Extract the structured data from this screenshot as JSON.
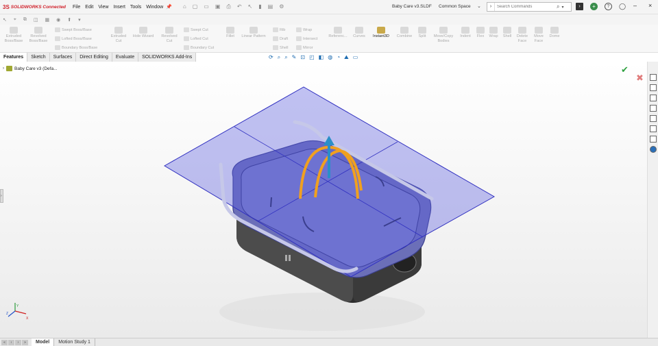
{
  "titlebar": {
    "logo_mark": "3S",
    "logo_text": "SOLIDWORKS Connected",
    "menu": [
      "File",
      "Edit",
      "View",
      "Insert",
      "Tools",
      "Window"
    ],
    "document_title": "Baby Care v3.SLDF",
    "space": "Common Space",
    "search_placeholder": "Search Commands",
    "cmd_glyph": "›"
  },
  "command_manager": {
    "tools": [
      {
        "label": "Extruded\nBoss/Base"
      },
      {
        "label": "Revolved\nBoss/Base"
      },
      {
        "label": "Extruded\nCut"
      },
      {
        "label": "Hole Wizard"
      },
      {
        "label": "Revolved\nCut"
      },
      {
        "label": "Fillet"
      },
      {
        "label": "Linear Pattern"
      },
      {
        "label": "Referenc..."
      },
      {
        "label": "Curves"
      },
      {
        "label": "Instant3D"
      },
      {
        "label": "Combine"
      },
      {
        "label": "Split"
      },
      {
        "label": "Move/Copy\nBodies"
      },
      {
        "label": "Indent"
      },
      {
        "label": "Flex"
      },
      {
        "label": "Wrap"
      },
      {
        "label": "Shell"
      },
      {
        "label": "Delete\nFace"
      },
      {
        "label": "Move\nFace"
      },
      {
        "label": "Dome"
      }
    ],
    "small_tools": {
      "swept_boss": "Swept Boss/Base",
      "lofted_boss": "Lofted Boss/Base",
      "boundary_boss": "Boundary Boss/Base",
      "swept_cut": "Swept Cut",
      "lofted_cut": "Lofted Cut",
      "boundary_cut": "Boundary Cut",
      "rib": "Rib",
      "draft": "Draft",
      "shell": "Shell",
      "wrap": "Wrap",
      "intersect": "Intersect",
      "mirror": "Mirror"
    }
  },
  "tabs": [
    "Features",
    "Sketch",
    "Surfaces",
    "Direct Editing",
    "Evaluate",
    "SOLIDWORKS Add-Ins"
  ],
  "active_tab": "Features",
  "feature_tree": {
    "root_label": "Baby Care v3 (Defa..."
  },
  "bottom_tabs": [
    "Model",
    "Motion Study 1"
  ],
  "active_bottom_tab": "Model",
  "triad": {
    "x": "X",
    "y": "Y",
    "z": "Z"
  },
  "colors": {
    "brand_red": "#d0202a",
    "plane_fill": "#5b5fe0",
    "drag_handle": "#f0a020",
    "arrow": "#2a8fc8",
    "accept_green": "#2ea140"
  }
}
